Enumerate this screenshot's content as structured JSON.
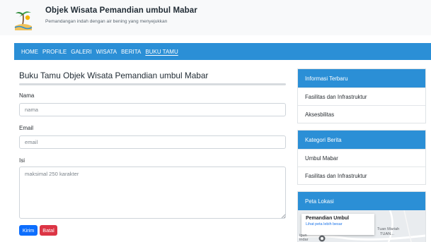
{
  "site": {
    "title": "Objek Wisata Pemandian umbul Mabar",
    "tagline": "Pemandangan indah dengan air bening yang menyejukkan"
  },
  "nav": {
    "items": [
      {
        "label": "HOME",
        "active": false
      },
      {
        "label": "PROFILE",
        "active": false
      },
      {
        "label": "GALERI",
        "active": false
      },
      {
        "label": "WISATA",
        "active": false
      },
      {
        "label": "BERITA",
        "active": false
      },
      {
        "label": "BUKU TAMU",
        "active": true
      }
    ]
  },
  "guestbook": {
    "title": "Buku Tamu Objek Wisata Pemandian umbul Mabar",
    "name_label": "Nama",
    "name_placeholder": "nama",
    "email_label": "Email",
    "email_placeholder": "email",
    "message_label": "Isi",
    "message_placeholder": "maksimal 250 karakter",
    "submit_label": "Kirim",
    "cancel_label": "Batal"
  },
  "sidebar": {
    "info": {
      "title": "Informasi Terbaru",
      "items": [
        "Fasilitas dan Infrastruktur",
        "Aksesbilitas"
      ]
    },
    "categories": {
      "title": "Kategori Berita",
      "items": [
        "Umbul Mabar",
        "Fasilitas dan Infrastruktur"
      ]
    },
    "map": {
      "title": "Peta Lokasi",
      "place_name": "Pemandian Umbul",
      "view_larger_link": "Lihat peta lebih besar",
      "labels": [
        "Tuan Mariah",
        "TUAN...",
        "igun",
        "indar"
      ]
    }
  },
  "colors": {
    "primary": "#2b8fd6",
    "submit": "#0d6efd",
    "cancel": "#dc3545",
    "header_bg": "#f8f9fa"
  }
}
